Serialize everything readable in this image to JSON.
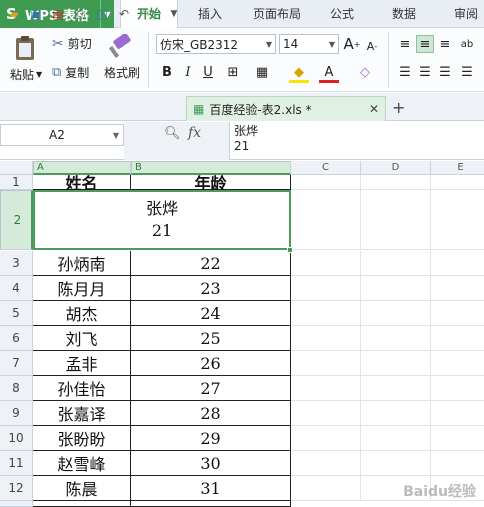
{
  "app": {
    "brand": "WPS 表格",
    "logo_letter": "S"
  },
  "ribbon_tabs": [
    "开始",
    "插入",
    "页面布局",
    "公式",
    "数据",
    "审阅"
  ],
  "ribbon": {
    "paste_label": "粘贴",
    "cut_label": "剪切",
    "copy_label": "复制",
    "format_painter_label": "格式刷",
    "font_name": "仿宋_GB2312",
    "font_size": "14",
    "bold": "B",
    "italic": "I",
    "underline": "U",
    "grow_font": "A",
    "shrink_font": "A",
    "font_color_glyph": "A"
  },
  "document_tab": {
    "title": "百度经验-表2.xls *",
    "new_tab": "+"
  },
  "formula_bar": {
    "cell_ref": "A2",
    "fx": "fx",
    "content": "张烨\n21"
  },
  "columns": [
    "A",
    "B",
    "C",
    "D",
    "E"
  ],
  "sheet": {
    "header": {
      "row": "1",
      "name": "姓名",
      "age": "年龄"
    },
    "merged_row": {
      "row": "2",
      "line1": "张烨",
      "line2": "21"
    },
    "rows": [
      {
        "row": "3",
        "name": "孙炳南",
        "age": "22"
      },
      {
        "row": "4",
        "name": "陈月月",
        "age": "23"
      },
      {
        "row": "5",
        "name": "胡杰",
        "age": "24"
      },
      {
        "row": "6",
        "name": "刘飞",
        "age": "25"
      },
      {
        "row": "7",
        "name": "孟非",
        "age": "26"
      },
      {
        "row": "8",
        "name": "孙佳怡",
        "age": "27"
      },
      {
        "row": "9",
        "name": "张嘉译",
        "age": "28"
      },
      {
        "row": "10",
        "name": "张盼盼",
        "age": "29"
      },
      {
        "row": "11",
        "name": "赵雪峰",
        "age": "30"
      },
      {
        "row": "12",
        "name": "陈晨",
        "age": "31"
      }
    ]
  },
  "watermark": "Baidu经验",
  "colors": {
    "brand_green": "#3f9b52",
    "selection_green": "#4a9c5a"
  }
}
